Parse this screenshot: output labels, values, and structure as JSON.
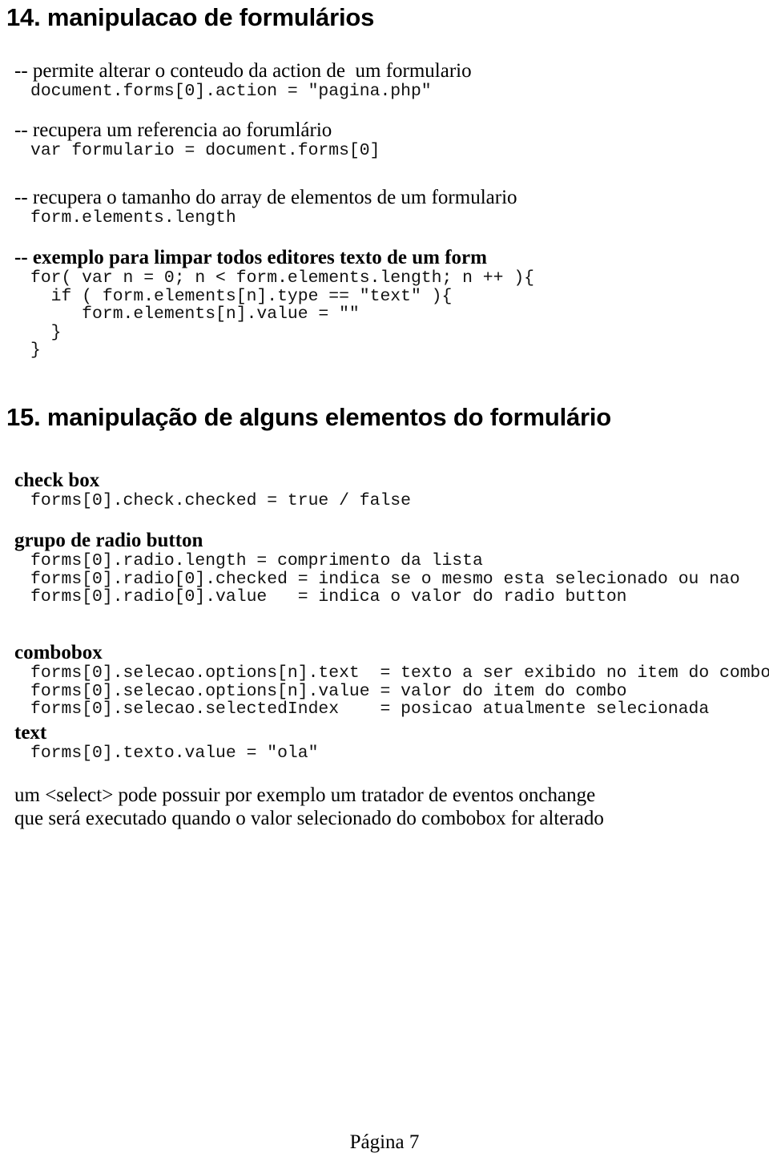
{
  "document": {
    "page_label": "Página 7",
    "language": "pt-BR"
  },
  "sections": [
    {
      "id": "section-14",
      "heading": "14. manipulacao de formulários",
      "items": [
        {
          "comment": "-- permite alterar o conteudo da action de  um formulario",
          "comment_bold": false,
          "code": [
            "document.forms[0].action = \"pagina.php\""
          ]
        },
        {
          "comment": "-- recupera um referencia ao forumlário",
          "comment_bold": false,
          "code": [
            "var formulario = document.forms[0]"
          ]
        },
        {
          "comment": "-- recupera o tamanho do array de elementos de um formulario",
          "comment_bold": false,
          "code": [
            "form.elements.length"
          ]
        },
        {
          "comment": "-- exemplo para limpar todos editores texto de um form",
          "comment_bold": true,
          "code": [
            "for( var n = 0; n < form.elements.length; n ++ ){",
            "  if ( form.elements[n].type == \"text\" ){",
            "     form.elements[n].value = \"\"",
            "  }",
            "}"
          ]
        }
      ]
    },
    {
      "id": "section-15",
      "heading": "15. manipulação de alguns elementos do formulário",
      "groups": [
        {
          "label": "check box",
          "code": [
            "forms[0].check.checked = true / false"
          ]
        },
        {
          "label": "grupo de radio button",
          "code": [
            "forms[0].radio.length = comprimento da lista",
            "forms[0].radio[0].checked = indica se o mesmo esta selecionado ou nao",
            "forms[0].radio[0].value   = indica o valor do radio button"
          ]
        },
        {
          "label": "combobox",
          "code": [
            "forms[0].selecao.options[n].text  = texto a ser exibido no item do combo",
            "forms[0].selecao.options[n].value = valor do item do combo",
            "forms[0].selecao.selectedIndex    = posicao atualmente selecionada"
          ]
        },
        {
          "label": "text",
          "code": [
            "forms[0].texto.value = \"ola\""
          ]
        }
      ],
      "closing_paragraph": [
        "um <select> pode possuir por exemplo um tratador de eventos onchange",
        "que será executado quando o valor selecionado do combobox for alterado"
      ]
    }
  ]
}
